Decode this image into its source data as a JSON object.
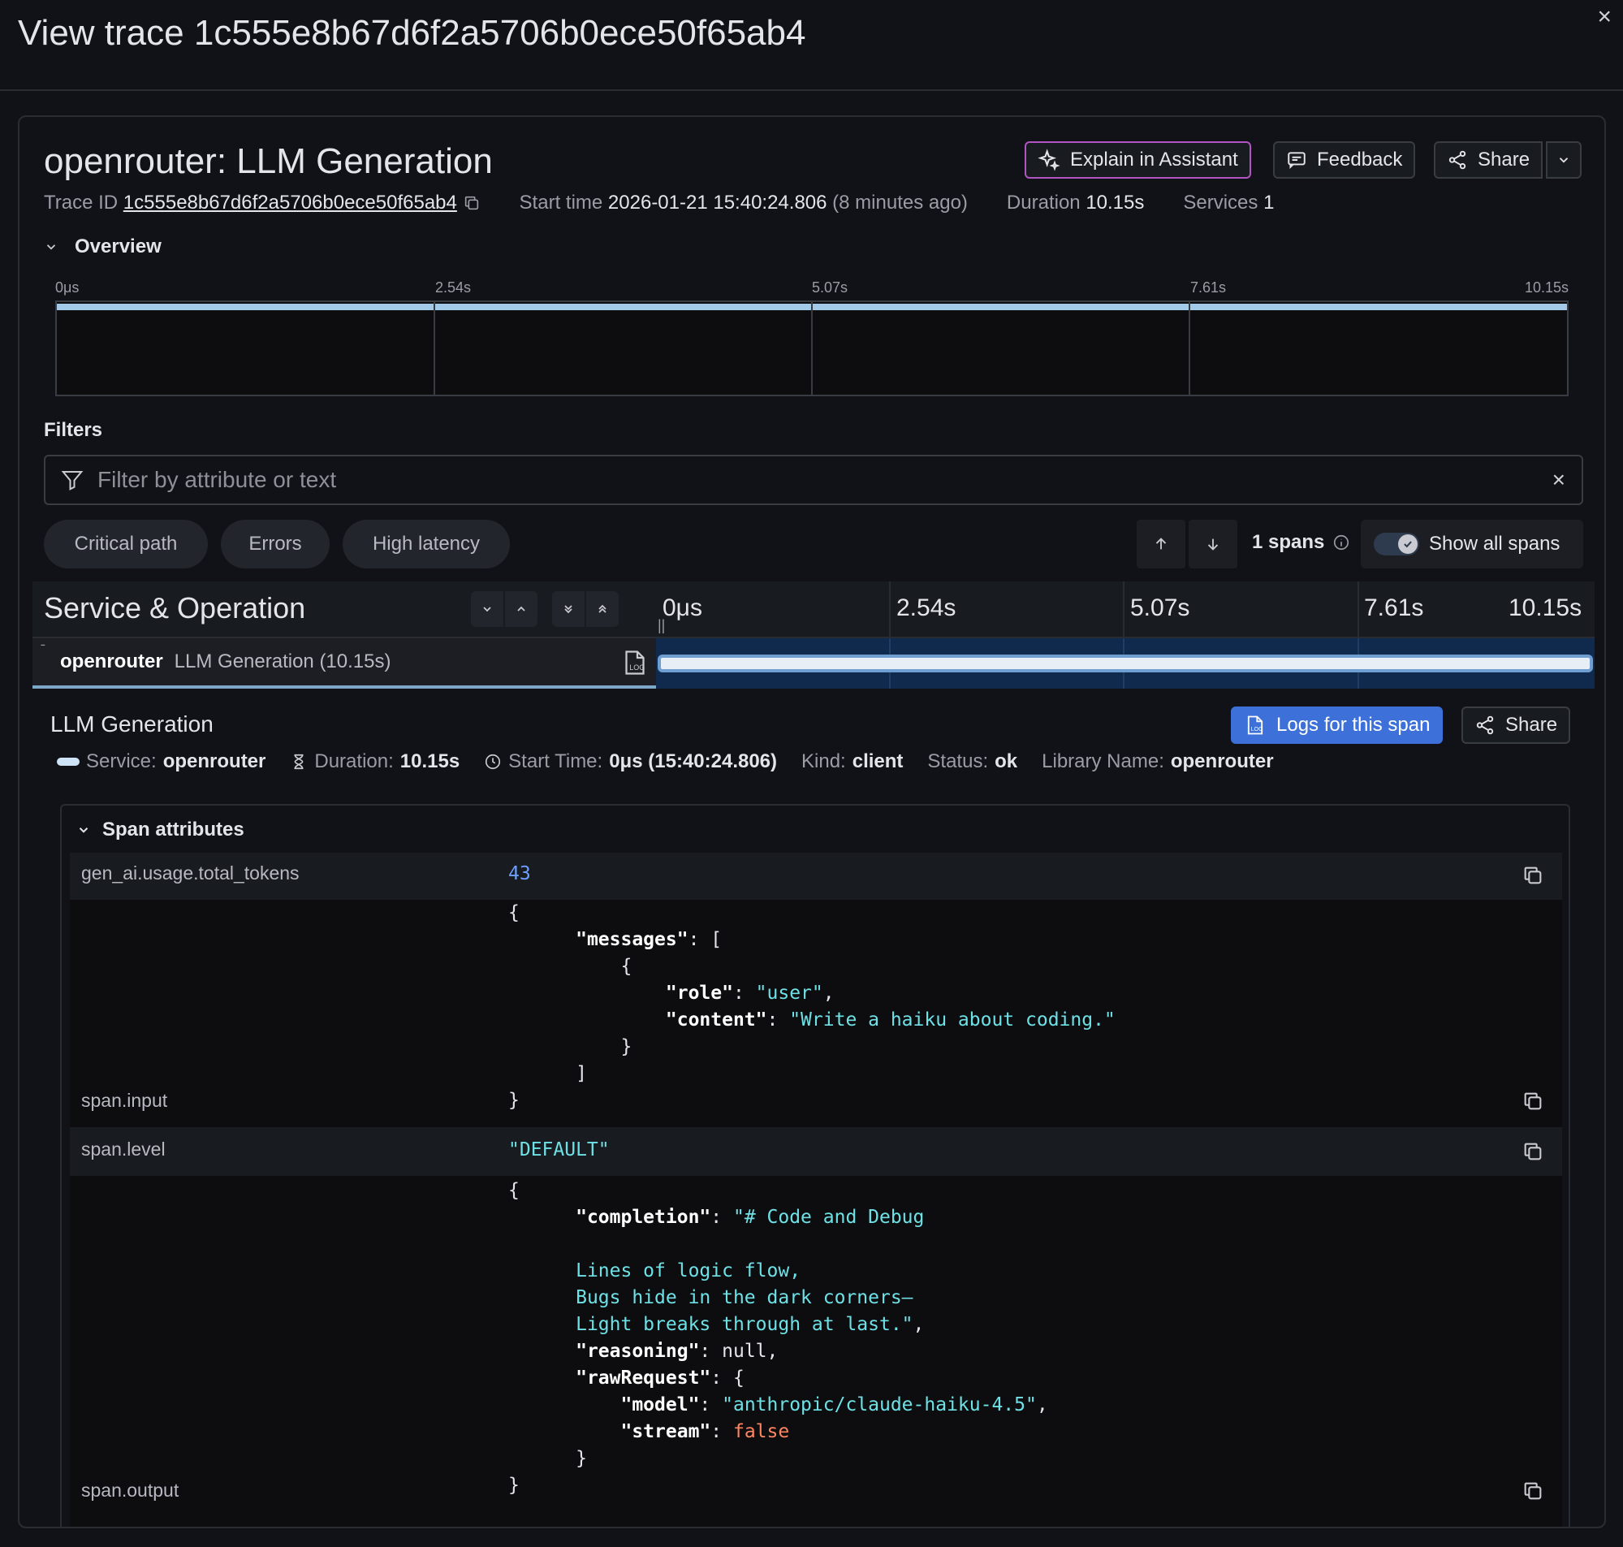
{
  "modal": {
    "title": "View trace 1c555e8b67d6f2a5706b0ece50f65ab4",
    "close_glyph": "×"
  },
  "trace": {
    "title": "openrouter: LLM Generation",
    "actions": {
      "explain_label": "Explain in Assistant",
      "feedback_label": "Feedback",
      "share_label": "Share"
    },
    "meta": {
      "trace_id_label": "Trace ID",
      "trace_id": "1c555e8b67d6f2a5706b0ece50f65ab4",
      "start_time_label": "Start time",
      "start_time": "2026-01-21 15:40:24.806",
      "start_time_relative": "(8 minutes ago)",
      "duration_label": "Duration",
      "duration": "10.15s",
      "services_label": "Services",
      "services": "1"
    }
  },
  "overview": {
    "label": "Overview",
    "ticks": [
      "0μs",
      "2.54s",
      "5.07s",
      "7.61s",
      "10.15s"
    ]
  },
  "filters": {
    "label": "Filters",
    "placeholder": "Filter by attribute or text",
    "chips": [
      "Critical path",
      "Errors",
      "High latency"
    ],
    "span_count": "1 spans",
    "show_all_label": "Show all spans",
    "show_all_enabled": true
  },
  "timeline": {
    "title": "Service & Operation",
    "ticks": [
      "0μs",
      "2.54s",
      "5.07s",
      "7.61s",
      "10.15s"
    ],
    "resize_glyph": "||"
  },
  "span": {
    "service": "openrouter",
    "operation": "LLM Generation (10.15s)",
    "collapse_glyph": "ˉ"
  },
  "details": {
    "title": "LLM Generation",
    "logs_label": "Logs for this span",
    "share_label": "Share",
    "meta": {
      "service_label": "Service:",
      "service": "openrouter",
      "duration_label": "Duration:",
      "duration": "10.15s",
      "start_label": "Start Time:",
      "start": "0μs (15:40:24.806)",
      "kind_label": "Kind:",
      "kind": "client",
      "status_label": "Status:",
      "status": "ok",
      "library_label": "Library Name:",
      "library": "openrouter"
    },
    "attributes_label": "Span attributes",
    "attributes": {
      "total_tokens": {
        "key": "gen_ai.usage.total_tokens",
        "value": "43"
      },
      "input": {
        "key": "span.input",
        "json": {
          "messages_key": "\"messages\"",
          "role_key": "\"role\"",
          "role_val": "\"user\"",
          "content_key": "\"content\"",
          "content_val": "\"Write a haiku about coding.\""
        }
      },
      "level": {
        "key": "span.level",
        "value": "\"DEFAULT\""
      },
      "output": {
        "key": "span.output",
        "json": {
          "completion_key": "\"completion\"",
          "completion_l1": "\"# Code and Debug",
          "completion_l2": "Lines of logic flow,",
          "completion_l3": "Bugs hide in the dark corners—",
          "completion_l4": "Light breaks through at last.\"",
          "reasoning_key": "\"reasoning\"",
          "reasoning_val": "null",
          "raw_key": "\"rawRequest\"",
          "model_key": "\"model\"",
          "model_val": "\"anthropic/claude-haiku-4.5\"",
          "stream_key": "\"stream\"",
          "stream_val": "false"
        }
      }
    }
  },
  "colors": {
    "accent_blue": "#3d71d9",
    "explain_border": "#b354c5",
    "span_bar": "#e8eef5",
    "json_string": "#6ee1e6",
    "json_number": "#6e9fff",
    "json_bool": "#ff8561"
  }
}
